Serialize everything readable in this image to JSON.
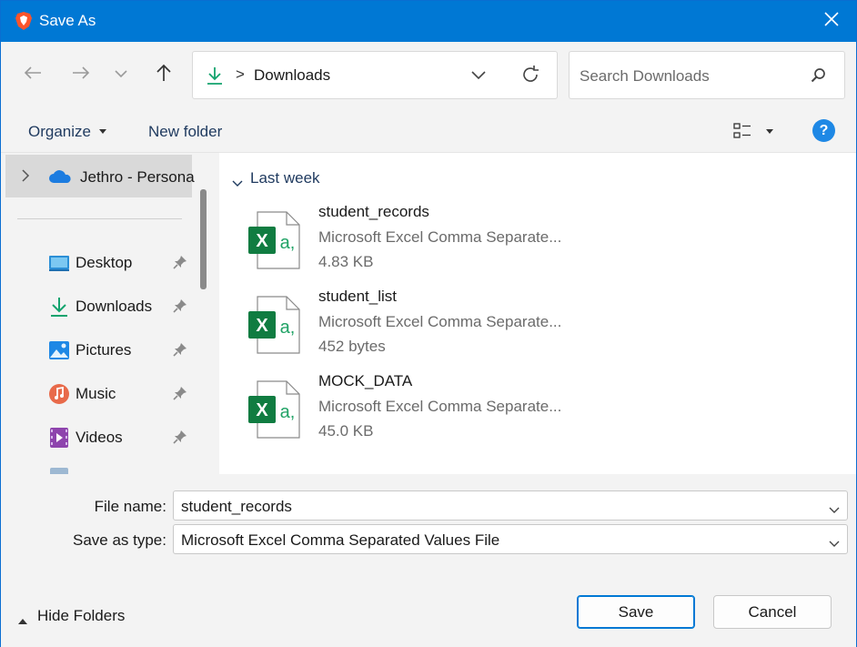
{
  "window": {
    "title": "Save As",
    "icons": {
      "app": "brave-browser-icon",
      "close": "close-icon"
    }
  },
  "nav": {
    "back_icon": "arrow-left-icon",
    "forward_icon": "arrow-right-icon",
    "recent_icon": "chevron-down-icon",
    "up_icon": "arrow-up-icon",
    "address": {
      "icon": "download-icon",
      "separator": ">",
      "path": "Downloads"
    },
    "refresh_icon": "refresh-icon",
    "search": {
      "placeholder": "Search Downloads",
      "icon": "search-icon"
    }
  },
  "toolbar": {
    "organize_label": "Organize",
    "new_folder_label": "New folder",
    "view_icon": "view-layout-icon",
    "help_icon": "help-icon",
    "help_label": "?"
  },
  "sidebar": {
    "root": {
      "label": "Jethro - Persona",
      "icon": "onedrive-cloud-icon"
    },
    "items": [
      {
        "label": "Desktop",
        "icon": "desktop-icon",
        "pinned": true
      },
      {
        "label": "Downloads",
        "icon": "download-icon",
        "pinned": true
      },
      {
        "label": "Pictures",
        "icon": "pictures-icon",
        "pinned": true
      },
      {
        "label": "Music",
        "icon": "music-icon",
        "pinned": true
      },
      {
        "label": "Videos",
        "icon": "videos-icon",
        "pinned": true
      }
    ]
  },
  "files": {
    "group_label": "Last week",
    "items": [
      {
        "name": "student_records",
        "type": "Microsoft Excel Comma Separate...",
        "size": "4.83 KB",
        "icon": "excel-csv-icon"
      },
      {
        "name": "student_list",
        "type": "Microsoft Excel Comma Separate...",
        "size": "452 bytes",
        "icon": "excel-csv-icon"
      },
      {
        "name": "MOCK_DATA",
        "type": "Microsoft Excel Comma Separate...",
        "size": "45.0 KB",
        "icon": "excel-csv-icon"
      }
    ]
  },
  "form": {
    "file_name_label": "File name:",
    "file_name_value": "student_records",
    "save_type_label": "Save as type:",
    "save_type_value": "Microsoft Excel Comma Separated Values File",
    "hide_folders_label": "Hide Folders",
    "save_label": "Save",
    "cancel_label": "Cancel"
  },
  "colors": {
    "accent": "#0078d4",
    "excel_green": "#107c41",
    "folder_blue": "#1f3a5f"
  }
}
